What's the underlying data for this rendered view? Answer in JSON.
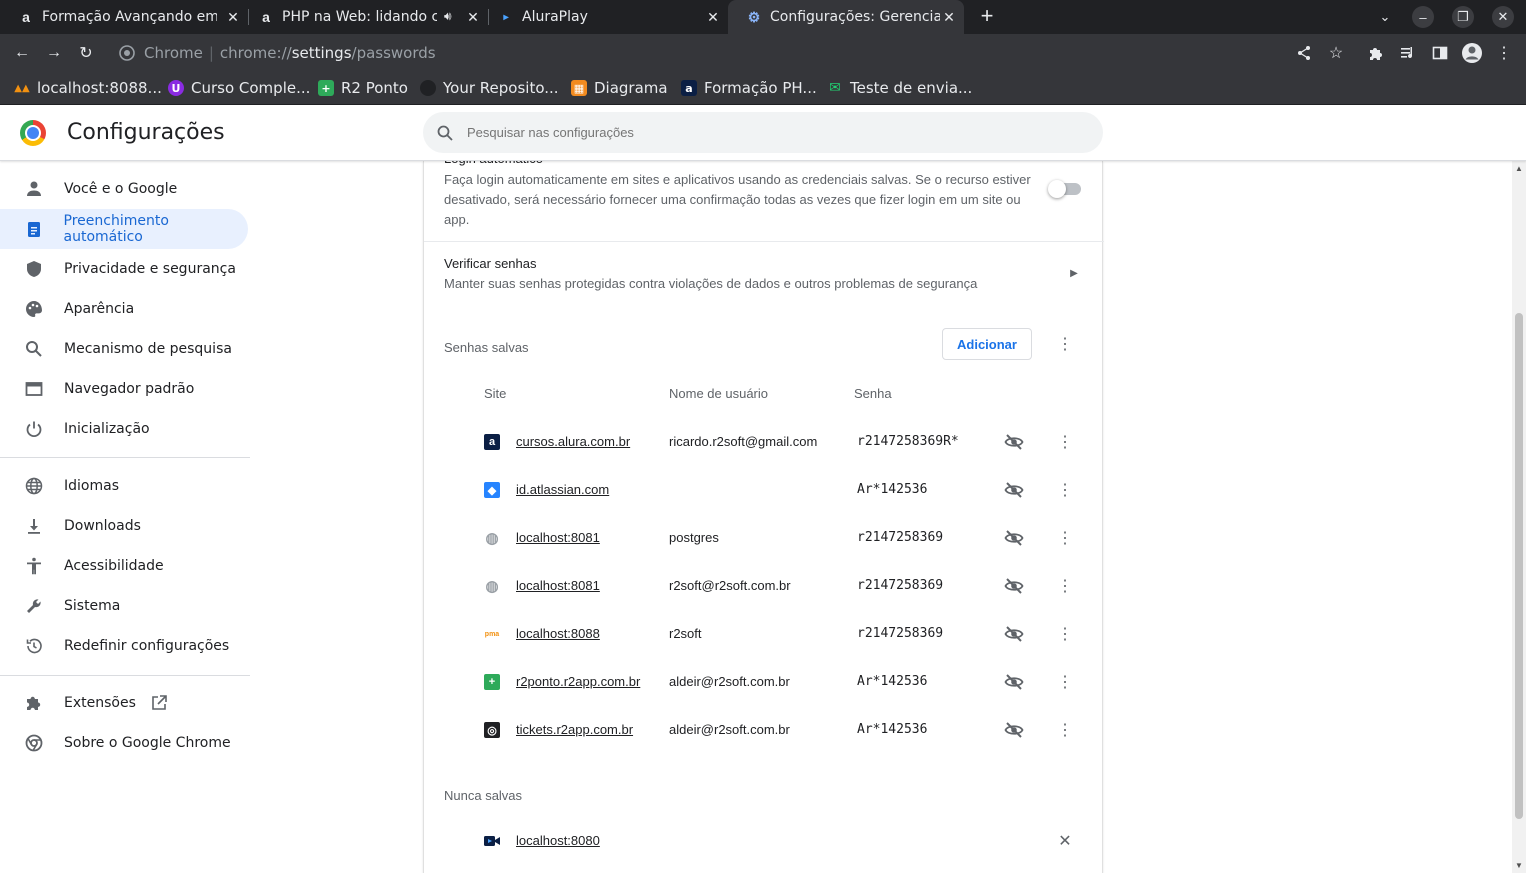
{
  "tabs": [
    {
      "title": "Formação Avançando em",
      "icon": "alura-icon",
      "glyph": "a"
    },
    {
      "title": "PHP na Web: lidando c",
      "icon": "alura-icon",
      "glyph": "a"
    },
    {
      "title": "AluraPlay",
      "icon": "aluraplay-icon",
      "glyph": "▸"
    },
    {
      "title": "Configurações: Gerenciad",
      "icon": "settings-gear-icon",
      "glyph": "⚙"
    }
  ],
  "address_bar": {
    "scheme_label": "Chrome",
    "url_prefix": "chrome://",
    "url_host": "settings",
    "url_path": "/passwords"
  },
  "bookmarks": [
    {
      "label": "localhost:8088...",
      "icon": "phpmyadmin-icon",
      "color": "#f29111"
    },
    {
      "label": "Curso Comple...",
      "icon": "course-shield-icon",
      "color": "#8a2be2"
    },
    {
      "label": "R2 Ponto",
      "icon": "r2ponto-icon",
      "color": "#2eaa5a"
    },
    {
      "label": "Your Reposito...",
      "icon": "github-icon",
      "color": "#202124"
    },
    {
      "label": "Diagrama",
      "icon": "diagram-icon",
      "color": "#f28b20"
    },
    {
      "label": "Formação PH...",
      "icon": "alura-icon",
      "color": "#0b1f44"
    },
    {
      "label": "Teste de envia...",
      "icon": "mailtrap-icon",
      "color": "#22d172"
    }
  ],
  "header": {
    "title": "Configurações",
    "search_placeholder": "Pesquisar nas configurações"
  },
  "sidebar": {
    "items": [
      {
        "label": "Você e o Google",
        "icon": "person-icon"
      },
      {
        "label": "Preenchimento automático",
        "icon": "clipboard-icon",
        "selected": true
      },
      {
        "label": "Privacidade e segurança",
        "icon": "shield-icon"
      },
      {
        "label": "Aparência",
        "icon": "palette-icon"
      },
      {
        "label": "Mecanismo de pesquisa",
        "icon": "search-icon"
      },
      {
        "label": "Navegador padrão",
        "icon": "browser-window-icon"
      },
      {
        "label": "Inicialização",
        "icon": "power-icon"
      }
    ],
    "items2": [
      {
        "label": "Idiomas",
        "icon": "globe-icon"
      },
      {
        "label": "Downloads",
        "icon": "download-icon"
      },
      {
        "label": "Acessibilidade",
        "icon": "accessibility-icon"
      },
      {
        "label": "Sistema",
        "icon": "wrench-icon"
      },
      {
        "label": "Redefinir configurações",
        "icon": "history-icon"
      }
    ],
    "items3": [
      {
        "label": "Extensões",
        "icon": "puzzle-icon"
      },
      {
        "label": "Sobre o Google Chrome",
        "icon": "chrome-icon"
      }
    ]
  },
  "autologin": {
    "title_clipped": "Login automático",
    "description": "Faça login automaticamente em sites e aplicativos usando as credenciais salvas. Se o recurso estiver desativado, será necessário fornecer uma confirmação todas as vezes que fizer login em um site ou app.",
    "enabled": false
  },
  "check_passwords": {
    "title": "Verificar senhas",
    "description": "Manter suas senhas protegidas contra violações de dados e outros problemas de segurança"
  },
  "saved": {
    "title": "Senhas salvas",
    "add_label": "Adicionar",
    "columns": {
      "site": "Site",
      "user": "Nome de usuário",
      "password": "Senha"
    },
    "rows": [
      {
        "site": "cursos.alura.com.br",
        "user": "ricardo.r2soft@gmail.com",
        "password": "r2147258369R*",
        "icon": "alura-icon",
        "icon_color": "#0b1f44",
        "glyph": "a"
      },
      {
        "site": "id.atlassian.com",
        "user": "",
        "password": "Ar*142536",
        "icon": "atlassian-icon",
        "icon_color": "#2684ff",
        "glyph": "◆"
      },
      {
        "site": "localhost:8081",
        "user": "postgres",
        "password": "r2147258369",
        "icon": "globe-icon",
        "icon_color": "#9aa0a6",
        "glyph": "◍"
      },
      {
        "site": "localhost:8081",
        "user": "r2soft@r2soft.com.br",
        "password": "r2147258369",
        "icon": "globe-icon",
        "icon_color": "#9aa0a6",
        "glyph": "◍"
      },
      {
        "site": "localhost:8088",
        "user": "r2soft",
        "password": "r2147258369",
        "icon": "phpmyadmin-icon",
        "icon_color": "#f29111",
        "glyph": "pma"
      },
      {
        "site": "r2ponto.r2app.com.br",
        "user": "aldeir@r2soft.com.br",
        "password": "Ar*142536",
        "icon": "r2ponto-icon",
        "icon_color": "#2eaa5a",
        "glyph": "+"
      },
      {
        "site": "tickets.r2app.com.br",
        "user": "aldeir@r2soft.com.br",
        "password": "Ar*142536",
        "icon": "tickets-icon",
        "icon_color": "#202124",
        "glyph": "◎"
      }
    ]
  },
  "never_saved": {
    "title": "Nunca salvas",
    "rows": [
      {
        "site": "localhost:8080",
        "icon": "video-camera-icon",
        "icon_color": "#0b1f44"
      }
    ]
  }
}
